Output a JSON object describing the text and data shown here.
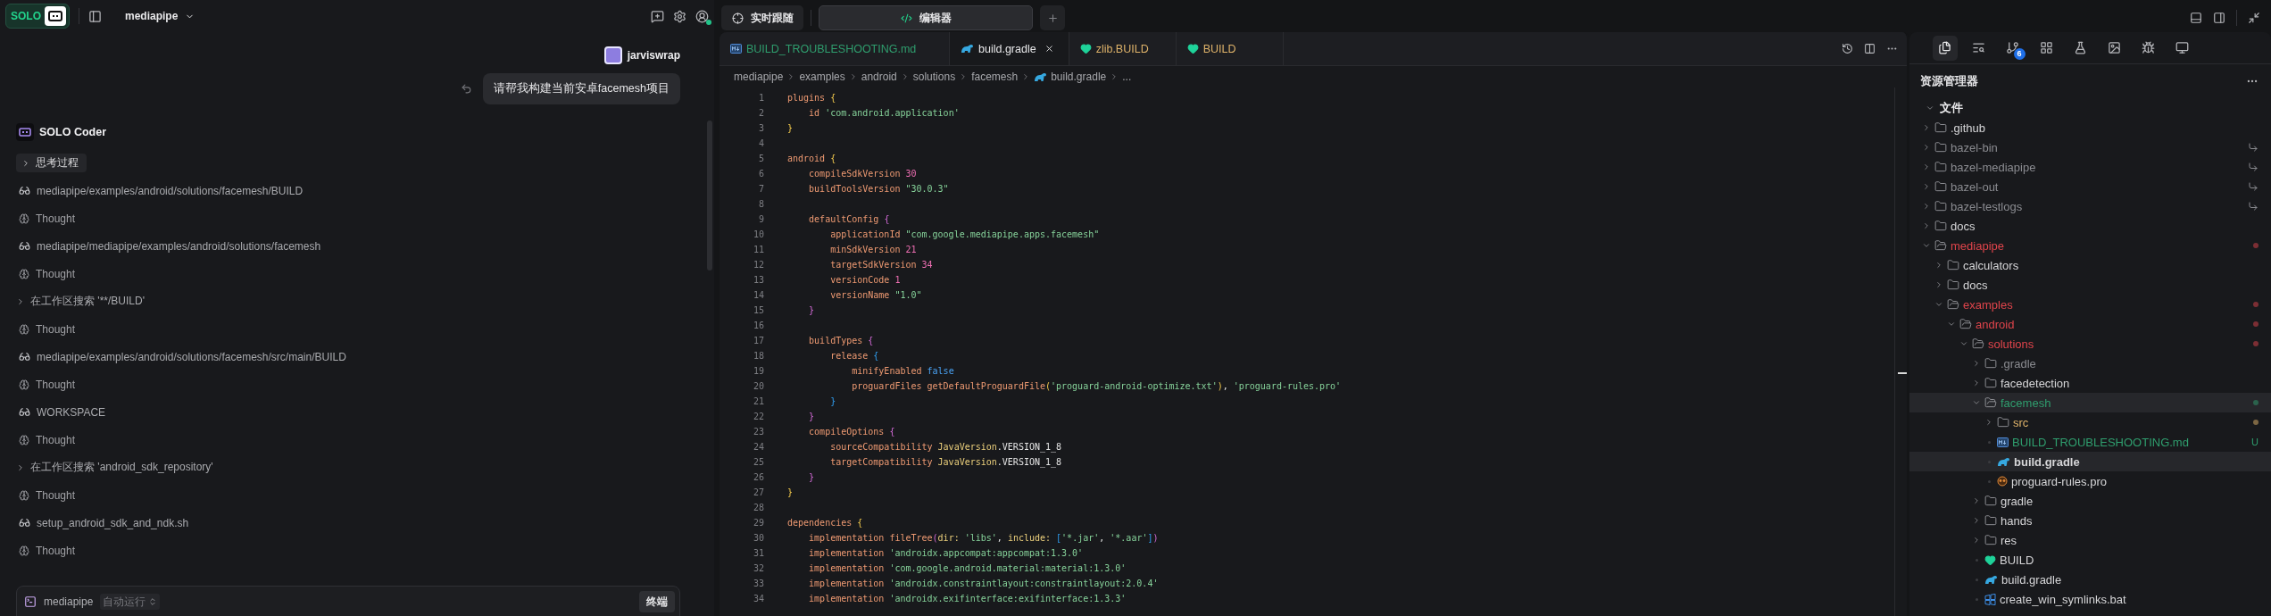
{
  "app": {
    "logo": "SOLO",
    "project": "mediapipe"
  },
  "chat": {
    "user": {
      "name": "jarviswrap",
      "message": "请帮我构建当前安卓facemesh项目"
    },
    "agent": "SOLO Coder",
    "steps": [
      {
        "kind": "thinking",
        "text": "思考过程",
        "expanded": false
      },
      {
        "kind": "read",
        "text": "mediapipe/examples/android/solutions/facemesh/BUILD"
      },
      {
        "kind": "thought",
        "text": "Thought"
      },
      {
        "kind": "read",
        "text": "mediapipe/mediapipe/examples/android/solutions/facemesh"
      },
      {
        "kind": "thought",
        "text": "Thought"
      },
      {
        "kind": "search",
        "text": "在工作区搜索 '**/BUILD'",
        "expanded": false
      },
      {
        "kind": "thought",
        "text": "Thought"
      },
      {
        "kind": "read",
        "text": "mediapipe/examples/android/solutions/facemesh/src/main/BUILD"
      },
      {
        "kind": "thought",
        "text": "Thought"
      },
      {
        "kind": "read",
        "text": "WORKSPACE"
      },
      {
        "kind": "thought",
        "text": "Thought"
      },
      {
        "kind": "search",
        "text": "在工作区搜索 'android_sdk_repository'",
        "expanded": false
      },
      {
        "kind": "thought",
        "text": "Thought"
      },
      {
        "kind": "read",
        "text": "setup_android_sdk_and_ndk.sh"
      },
      {
        "kind": "thought",
        "text": "Thought"
      }
    ]
  },
  "composer": {
    "project": "mediapipe",
    "mode": "自动运行",
    "button": "终端"
  },
  "views": [
    {
      "kind": "follow",
      "label": "实时跟随",
      "selected": false
    },
    {
      "kind": "editor",
      "label": "编辑器",
      "selected": true
    }
  ],
  "editor_tabs": [
    {
      "label": "BUILD_TROUBLESHOOTING.md",
      "kind": "md",
      "color": "#2f9e6e",
      "selected": false
    },
    {
      "label": "build.gradle",
      "kind": "gradle",
      "selected": true
    },
    {
      "label": "zlib.BUILD",
      "kind": "bazel",
      "color": "#dfb36a",
      "selected": false
    },
    {
      "label": "BUILD",
      "kind": "bazel",
      "color": "#dfb36a",
      "selected": false
    }
  ],
  "breadcrumbs": [
    {
      "label": "mediapipe"
    },
    {
      "label": "examples"
    },
    {
      "label": "android"
    },
    {
      "label": "solutions"
    },
    {
      "label": "facemesh"
    },
    {
      "label": "build.gradle",
      "kind": "gradle"
    },
    {
      "label": "..."
    }
  ],
  "code": [
    {
      "n": "1",
      "tokens": [
        {
          "text": "plugins ",
          "kind": "keyword"
        },
        {
          "text": "{",
          "kind": "brace1"
        }
      ]
    },
    {
      "n": "2",
      "tokens": [
        {
          "text": "    id ",
          "kind": "keyword"
        },
        {
          "text": "'com.android.application'",
          "kind": "string"
        }
      ]
    },
    {
      "n": "3",
      "tokens": [
        {
          "text": "}",
          "kind": "brace1"
        }
      ]
    },
    {
      "n": "4"
    },
    {
      "n": "5",
      "tokens": [
        {
          "text": "android ",
          "kind": "keyword"
        },
        {
          "text": "{",
          "kind": "brace1"
        }
      ]
    },
    {
      "n": "6",
      "tokens": [
        {
          "text": "    compileSdkVersion ",
          "kind": "keyword"
        },
        {
          "text": "30",
          "kind": "number"
        }
      ]
    },
    {
      "n": "7",
      "tokens": [
        {
          "text": "    buildToolsVersion ",
          "kind": "keyword"
        },
        {
          "text": "\"30.0.3\"",
          "kind": "string"
        }
      ]
    },
    {
      "n": "8"
    },
    {
      "n": "9",
      "tokens": [
        {
          "text": "    defaultConfig ",
          "kind": "keyword"
        },
        {
          "text": "{",
          "kind": "brace2"
        }
      ]
    },
    {
      "n": "10",
      "tokens": [
        {
          "text": "        applicationId ",
          "kind": "keyword"
        },
        {
          "text": "\"com.google.mediapipe.apps.facemesh\"",
          "kind": "string"
        }
      ]
    },
    {
      "n": "11",
      "tokens": [
        {
          "text": "        minSdkVersion ",
          "kind": "keyword"
        },
        {
          "text": "21",
          "kind": "number"
        }
      ]
    },
    {
      "n": "12",
      "tokens": [
        {
          "text": "        targetSdkVersion ",
          "kind": "keyword"
        },
        {
          "text": "34",
          "kind": "number"
        }
      ]
    },
    {
      "n": "13",
      "tokens": [
        {
          "text": "        versionCode ",
          "kind": "keyword"
        },
        {
          "text": "1",
          "kind": "number"
        }
      ]
    },
    {
      "n": "14",
      "tokens": [
        {
          "text": "        versionName ",
          "kind": "keyword"
        },
        {
          "text": "\"1.0\"",
          "kind": "string"
        }
      ]
    },
    {
      "n": "15",
      "tokens": [
        {
          "text": "    }",
          "kind": "brace2"
        }
      ]
    },
    {
      "n": "16"
    },
    {
      "n": "17",
      "tokens": [
        {
          "text": "    buildTypes ",
          "kind": "keyword"
        },
        {
          "text": "{",
          "kind": "brace2"
        }
      ]
    },
    {
      "n": "18",
      "tokens": [
        {
          "text": "        release ",
          "kind": "keyword"
        },
        {
          "text": "{",
          "kind": "brace3"
        }
      ]
    },
    {
      "n": "19",
      "tokens": [
        {
          "text": "            minifyEnabled ",
          "kind": "keyword"
        },
        {
          "text": "false",
          "kind": "boolean"
        }
      ]
    },
    {
      "n": "20",
      "tokens": [
        {
          "text": "            proguardFiles getDefaultProguardFile",
          "kind": "keyword"
        },
        {
          "text": "(",
          "kind": "brace1"
        },
        {
          "text": "'proguard-android-optimize.txt'",
          "kind": "string"
        },
        {
          "text": ")",
          "kind": "brace1"
        },
        {
          "text": ", ",
          "kind": "plain"
        },
        {
          "text": "'proguard-rules.pro'",
          "kind": "string"
        }
      ]
    },
    {
      "n": "21",
      "tokens": [
        {
          "text": "        }",
          "kind": "brace3"
        }
      ]
    },
    {
      "n": "22",
      "tokens": [
        {
          "text": "    }",
          "kind": "brace2"
        }
      ]
    },
    {
      "n": "23",
      "tokens": [
        {
          "text": "    compileOptions ",
          "kind": "keyword"
        },
        {
          "text": "{",
          "kind": "brace2"
        }
      ]
    },
    {
      "n": "24",
      "tokens": [
        {
          "text": "        sourceCompatibility ",
          "kind": "keyword"
        },
        {
          "text": "JavaVersion",
          "kind": "type"
        },
        {
          "text": ".VERSION_1_8",
          "kind": "plain"
        }
      ]
    },
    {
      "n": "25",
      "tokens": [
        {
          "text": "        targetCompatibility ",
          "kind": "keyword"
        },
        {
          "text": "JavaVersion",
          "kind": "type"
        },
        {
          "text": ".VERSION_1_8",
          "kind": "plain"
        }
      ]
    },
    {
      "n": "26",
      "tokens": [
        {
          "text": "    }",
          "kind": "brace2"
        }
      ]
    },
    {
      "n": "27",
      "tokens": [
        {
          "text": "}",
          "kind": "brace1"
        }
      ]
    },
    {
      "n": "28"
    },
    {
      "n": "29",
      "tokens": [
        {
          "text": "dependencies ",
          "kind": "keyword"
        },
        {
          "text": "{",
          "kind": "brace1"
        }
      ]
    },
    {
      "n": "30",
      "tokens": [
        {
          "text": "    implementation fileTree",
          "kind": "keyword"
        },
        {
          "text": "(",
          "kind": "brace2"
        },
        {
          "text": "dir: ",
          "kind": "type"
        },
        {
          "text": "'libs'",
          "kind": "string"
        },
        {
          "text": ", ",
          "kind": "plain"
        },
        {
          "text": "include: ",
          "kind": "type"
        },
        {
          "text": "[",
          "kind": "brace3"
        },
        {
          "text": "'*.jar'",
          "kind": "string"
        },
        {
          "text": ", ",
          "kind": "plain"
        },
        {
          "text": "'*.aar'",
          "kind": "string"
        },
        {
          "text": "]",
          "kind": "brace3"
        },
        {
          "text": ")",
          "kind": "brace2"
        }
      ]
    },
    {
      "n": "31",
      "tokens": [
        {
          "text": "    implementation ",
          "kind": "keyword"
        },
        {
          "text": "'androidx.appcompat:appcompat:1.3.0'",
          "kind": "string"
        }
      ]
    },
    {
      "n": "32",
      "tokens": [
        {
          "text": "    implementation ",
          "kind": "keyword"
        },
        {
          "text": "'com.google.android.material:material:1.3.0'",
          "kind": "string"
        }
      ]
    },
    {
      "n": "33",
      "tokens": [
        {
          "text": "    implementation ",
          "kind": "keyword"
        },
        {
          "text": "'androidx.constraintlayout:constraintlayout:2.0.4'",
          "kind": "string"
        }
      ]
    },
    {
      "n": "34",
      "tokens": [
        {
          "text": "    implementation ",
          "kind": "keyword"
        },
        {
          "text": "'androidx.exifinterface:exifinterface:1.3.3'",
          "kind": "string"
        }
      ]
    }
  ],
  "activity": [
    {
      "kind": "files",
      "selected": true
    },
    {
      "kind": "search",
      "selected": false
    },
    {
      "kind": "git",
      "selected": false,
      "badge": "6"
    },
    {
      "kind": "extensions",
      "selected": false
    },
    {
      "kind": "flask",
      "selected": false
    },
    {
      "kind": "image",
      "selected": false
    },
    {
      "kind": "bug",
      "selected": false
    },
    {
      "kind": "monitor",
      "selected": false
    }
  ],
  "explorer": {
    "title": "资源管理器",
    "section": {
      "label": "文件",
      "expanded": true
    },
    "tree": [
      {
        "name": ".github",
        "kind": "folder",
        "expanded": false,
        "selected": false
      },
      {
        "name": "bazel-bin",
        "kind": "folder",
        "expanded": false,
        "color": "#8a8b90",
        "symlink": true,
        "selected": false
      },
      {
        "name": "bazel-mediapipe",
        "kind": "folder",
        "expanded": false,
        "color": "#8a8b90",
        "symlink": true,
        "selected": false
      },
      {
        "name": "bazel-out",
        "kind": "folder",
        "expanded": false,
        "color": "#8a8b90",
        "symlink": true,
        "selected": false
      },
      {
        "name": "bazel-testlogs",
        "kind": "folder",
        "expanded": false,
        "color": "#8a8b90",
        "symlink": true,
        "selected": false
      },
      {
        "name": "docs",
        "kind": "folder",
        "expanded": false,
        "selected": false
      },
      {
        "name": "mediapipe",
        "kind": "folder",
        "expanded": true,
        "color": "#e0444b",
        "dot": true,
        "selected": false,
        "children": [
          {
            "name": "calculators",
            "kind": "folder",
            "expanded": false,
            "selected": false
          },
          {
            "name": "docs",
            "kind": "folder",
            "expanded": false,
            "selected": false
          },
          {
            "name": "examples",
            "kind": "folder",
            "expanded": true,
            "color": "#e0444b",
            "dot": true,
            "selected": false,
            "children": [
              {
                "name": "android",
                "kind": "folder",
                "expanded": true,
                "color": "#e0444b",
                "dot": true,
                "selected": false,
                "children": [
                  {
                    "name": "solutions",
                    "kind": "folder",
                    "expanded": true,
                    "color": "#e0444b",
                    "dot": true,
                    "selected": false,
                    "children": [
                      {
                        "name": ".gradle",
                        "kind": "folder",
                        "expanded": false,
                        "color": "#8a8b90",
                        "selected": false
                      },
                      {
                        "name": "facedetection",
                        "kind": "folder",
                        "expanded": false,
                        "selected": false
                      },
                      {
                        "name": "facemesh",
                        "kind": "folder",
                        "expanded": true,
                        "color": "#2f9e6e",
                        "dot": true,
                        "selected": true,
                        "children": [
                          {
                            "name": "src",
                            "kind": "folder",
                            "expanded": false,
                            "color": "#dfb36a",
                            "dot": true,
                            "selected": false
                          },
                          {
                            "name": "BUILD_TROUBLESHOOTING.md",
                            "kind": "md",
                            "color": "#2f9e6e",
                            "badge": "U",
                            "selected": false
                          },
                          {
                            "name": "build.gradle",
                            "kind": "gradle",
                            "selected": true
                          },
                          {
                            "name": "proguard-rules.pro",
                            "kind": "proguard",
                            "selected": false
                          }
                        ]
                      },
                      {
                        "name": "gradle",
                        "kind": "folder",
                        "expanded": false,
                        "selected": false
                      },
                      {
                        "name": "hands",
                        "kind": "folder",
                        "expanded": false,
                        "selected": false
                      },
                      {
                        "name": "res",
                        "kind": "folder",
                        "expanded": false,
                        "selected": false
                      },
                      {
                        "name": "BUILD",
                        "kind": "bazel",
                        "selected": false
                      },
                      {
                        "name": "build.gradle",
                        "kind": "gradle",
                        "selected": false
                      },
                      {
                        "name": "create_win_symlinks.bat",
                        "kind": "bat",
                        "selected": false
                      }
                    ]
                  }
                ]
              }
            ]
          }
        ]
      }
    ]
  }
}
